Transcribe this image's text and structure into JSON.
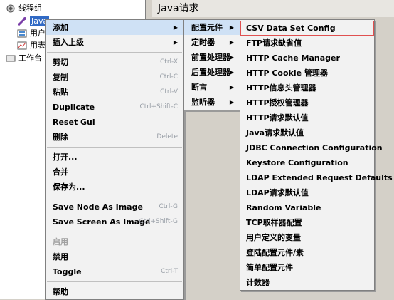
{
  "tree": {
    "items": [
      {
        "label": "线程组",
        "icon": "thread-group-icon"
      },
      {
        "label": "Java",
        "icon": "java-sampler-icon",
        "selected": true
      },
      {
        "label": "用户",
        "icon": "user-config-icon"
      },
      {
        "label": "用表",
        "icon": "graph-listener-icon"
      },
      {
        "label": "工作台",
        "icon": "workbench-icon"
      }
    ]
  },
  "right_panel": {
    "title": "Java请求"
  },
  "context_menu": {
    "items": [
      {
        "label": "添加",
        "submenu": true,
        "highlighted": true
      },
      {
        "label": "插入上级",
        "submenu": true
      },
      {
        "sep": true
      },
      {
        "label": "剪切",
        "shortcut": "Ctrl-X"
      },
      {
        "label": "复制",
        "shortcut": "Ctrl-C"
      },
      {
        "label": "粘贴",
        "shortcut": "Ctrl-V"
      },
      {
        "label": "Duplicate",
        "shortcut": "Ctrl+Shift-C"
      },
      {
        "label": "Reset Gui"
      },
      {
        "label": "删除",
        "shortcut": "Delete"
      },
      {
        "sep": true
      },
      {
        "label": "打开..."
      },
      {
        "label": "合并"
      },
      {
        "label": "保存为..."
      },
      {
        "sep": true
      },
      {
        "label": "Save Node As Image",
        "shortcut": "Ctrl-G"
      },
      {
        "label": "Save Screen As Image",
        "shortcut": "Ctrl+Shift-G"
      },
      {
        "sep": true
      },
      {
        "label": "启用",
        "disabled": true
      },
      {
        "label": "禁用"
      },
      {
        "label": "Toggle",
        "shortcut": "Ctrl-T"
      },
      {
        "sep": true
      },
      {
        "label": "帮助"
      }
    ]
  },
  "add_submenu": {
    "items": [
      {
        "label": "配置元件",
        "submenu": true,
        "highlighted": true
      },
      {
        "label": "定时器",
        "submenu": true
      },
      {
        "label": "前置处理器",
        "submenu": true
      },
      {
        "label": "后置处理器",
        "submenu": true
      },
      {
        "label": "断言",
        "submenu": true
      },
      {
        "label": "监听器",
        "submenu": true
      }
    ]
  },
  "config_submenu": {
    "items": [
      {
        "label": "CSV Data Set Config",
        "outlined": true
      },
      {
        "label": "FTP请求缺省值"
      },
      {
        "label": "HTTP Cache Manager"
      },
      {
        "label": "HTTP Cookie 管理器"
      },
      {
        "label": "HTTP信息头管理器"
      },
      {
        "label": "HTTP授权管理器"
      },
      {
        "label": "HTTP请求默认值"
      },
      {
        "label": "Java请求默认值"
      },
      {
        "label": "JDBC Connection Configuration"
      },
      {
        "label": "Keystore Configuration"
      },
      {
        "label": "LDAP Extended Request Defaults"
      },
      {
        "label": "LDAP请求默认值"
      },
      {
        "label": "Random Variable"
      },
      {
        "label": "TCP取样器配置"
      },
      {
        "label": "用户定义的变量"
      },
      {
        "label": "登陆配置元件/素"
      },
      {
        "label": "简单配置元件"
      },
      {
        "label": "计数器"
      }
    ]
  },
  "colors": {
    "highlight": "#cfe1f5",
    "selection": "#316ac5",
    "outline": "#e05050"
  }
}
